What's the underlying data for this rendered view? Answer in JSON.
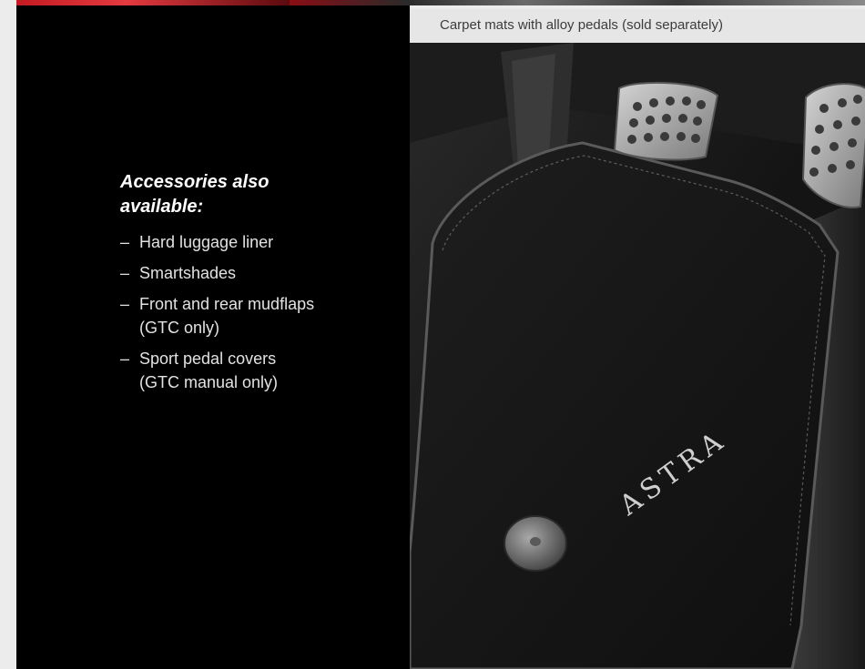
{
  "caption": "Carpet mats with alloy pedals (sold separately)",
  "heading": "Accessories also available:",
  "list": [
    "Hard luggage liner",
    "Smartshades",
    "Front and rear mudflaps\n(GTC only)",
    "Sport pedal covers\n(GTC manual only)"
  ],
  "photo": {
    "mat_lettering": "ASTRA"
  },
  "colors": {
    "panel": "#000000",
    "page": "#ececec",
    "caption_bar": "#e6e6e6",
    "accent": "#c41a22"
  }
}
